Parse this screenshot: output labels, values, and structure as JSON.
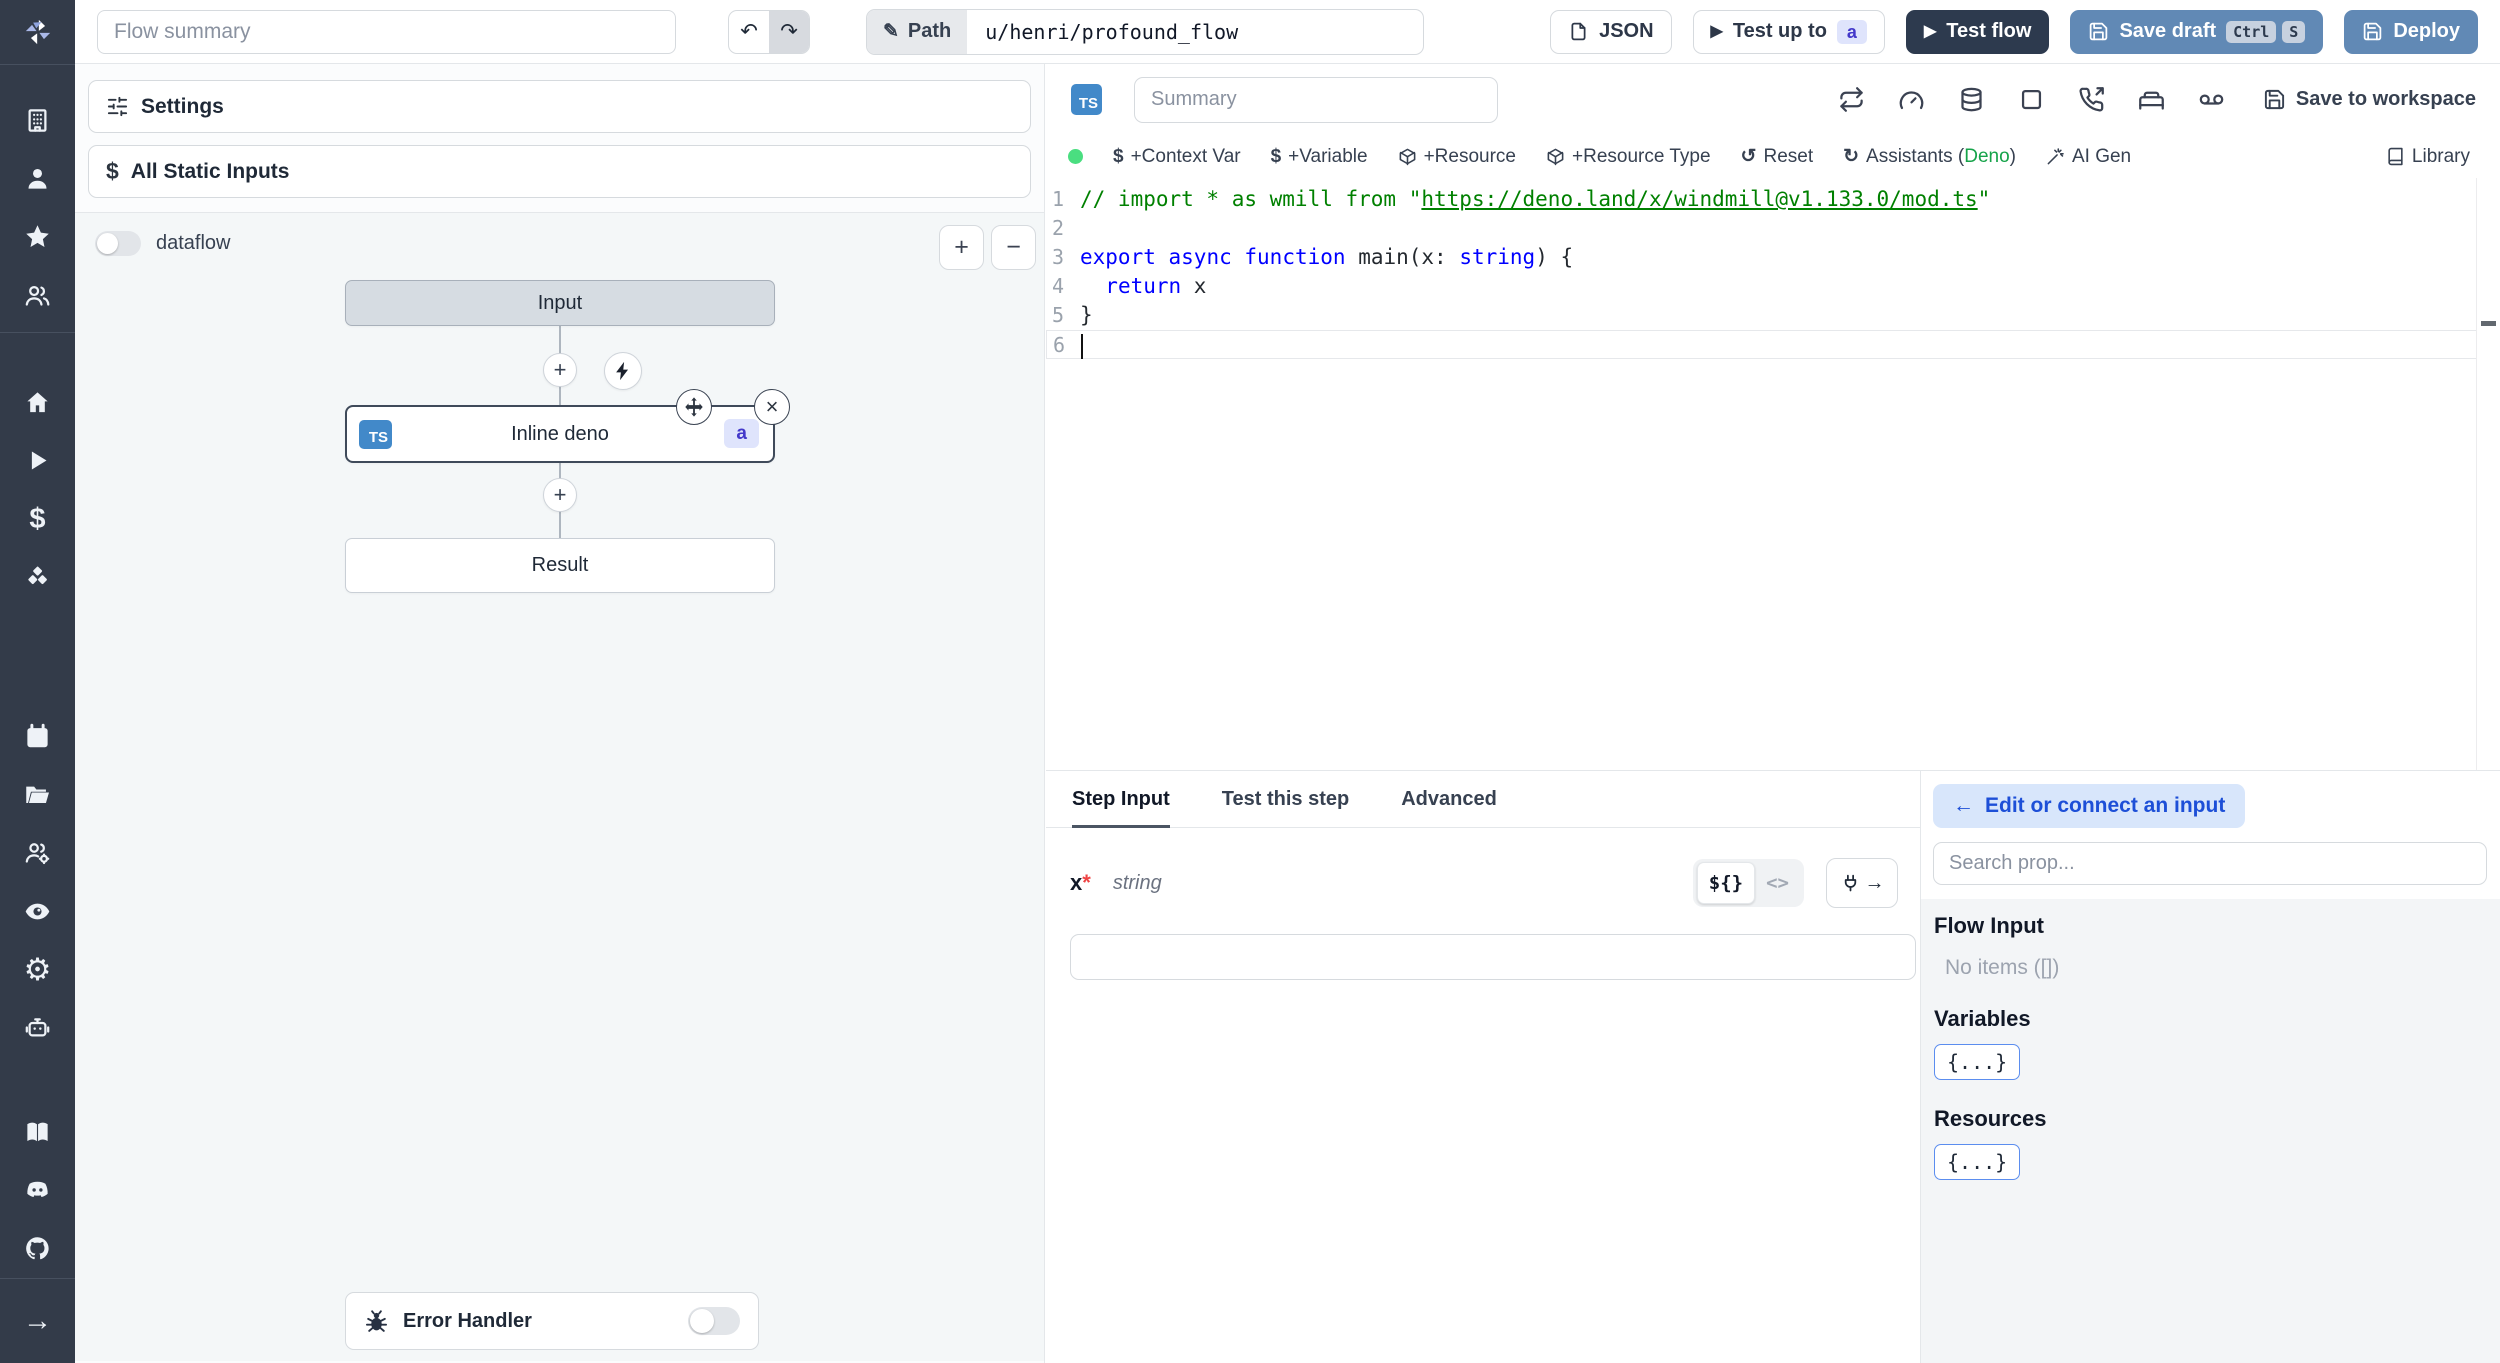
{
  "icons": {
    "gear": "⚙",
    "arrow_right": "→",
    "back_arrow": "←",
    "dollar": "$",
    "pencil": "✎",
    "undo": "↶",
    "redo": "↷",
    "play": "▶",
    "close": "×",
    "plus": "+",
    "minus": "−",
    "reset": "↺",
    "refresh": "↻"
  },
  "topbar": {
    "flow_summary_placeholder": "Flow summary",
    "path_label": "Path",
    "path_value": "u/henri/profound_flow",
    "json_button": "JSON",
    "test_up_to": "Test up to",
    "test_up_to_step": "a",
    "test_flow": "Test flow",
    "save_draft": "Save draft",
    "kbd": [
      "Ctrl",
      "S"
    ],
    "deploy": "Deploy"
  },
  "left_panel": {
    "settings": "Settings",
    "all_static_inputs": "All Static Inputs",
    "dataflow": "dataflow",
    "graph": {
      "input": "Input",
      "step_lang": "TS",
      "step_name": "Inline deno",
      "step_id": "a",
      "result": "Result"
    },
    "error_handler": "Error Handler"
  },
  "editor": {
    "lang_badge": "TS",
    "summary_placeholder": "Summary",
    "save_to_workspace": "Save to workspace",
    "toolbar": {
      "context_var": "+Context Var",
      "variable": "+Variable",
      "resource": "+Resource",
      "resource_type": "+Resource Type",
      "reset": "Reset",
      "assistants_prefix": "Assistants (",
      "assistants_lang": "Deno",
      "assistants_suffix": ")",
      "ai_gen": "AI Gen",
      "library": "Library"
    },
    "code": {
      "lines": [
        {
          "num": "1",
          "tokens": [
            {
              "t": "// import * as wmill from \"",
              "c": "comment"
            },
            {
              "t": "https://deno.land/x/windmill@v1.133.0/mod.ts",
              "c": "link"
            },
            {
              "t": "\"",
              "c": "comment"
            }
          ]
        },
        {
          "num": "2",
          "tokens": []
        },
        {
          "num": "3",
          "tokens": [
            {
              "t": "export",
              "c": "kw"
            },
            {
              "t": " ",
              "c": "plain"
            },
            {
              "t": "async",
              "c": "kw"
            },
            {
              "t": " ",
              "c": "plain"
            },
            {
              "t": "function",
              "c": "kw"
            },
            {
              "t": " main(x: ",
              "c": "plain"
            },
            {
              "t": "string",
              "c": "kw"
            },
            {
              "t": ") {",
              "c": "plain"
            }
          ]
        },
        {
          "num": "4",
          "tokens": [
            {
              "t": "  ",
              "c": "plain"
            },
            {
              "t": "return",
              "c": "kw"
            },
            {
              "t": " x",
              "c": "plain"
            }
          ]
        },
        {
          "num": "5",
          "tokens": [
            {
              "t": "}",
              "c": "plain"
            }
          ]
        },
        {
          "num": "6",
          "tokens": [],
          "current": true,
          "cursor": true
        }
      ]
    }
  },
  "step_panel": {
    "tabs": [
      "Step Input",
      "Test this step",
      "Advanced"
    ],
    "field_name": "x",
    "required_mark": "*",
    "field_type": "string",
    "expr_toggle": "${}",
    "code_toggle": "<>",
    "input_value": ""
  },
  "connect_panel": {
    "edit_button": "Edit or connect an input",
    "search_placeholder": "Search prop...",
    "flow_input_title": "Flow Input",
    "flow_input_empty": "No items ([])",
    "variables_title": "Variables",
    "resources_title": "Resources",
    "object_chip": "{...}"
  },
  "colors": {
    "sidebar_bg": "#333b49",
    "button_blue": "#6189b5",
    "button_dark": "#2d3a4e",
    "ts_badge_blue": "#4289c9",
    "step_badge_bg": "#dfe4fc",
    "step_badge_text": "#4338ca",
    "green_dot": "#4ade80",
    "deno_green": "#16a34a",
    "code_keyword": "#0000ff",
    "code_comment": "#008000"
  }
}
